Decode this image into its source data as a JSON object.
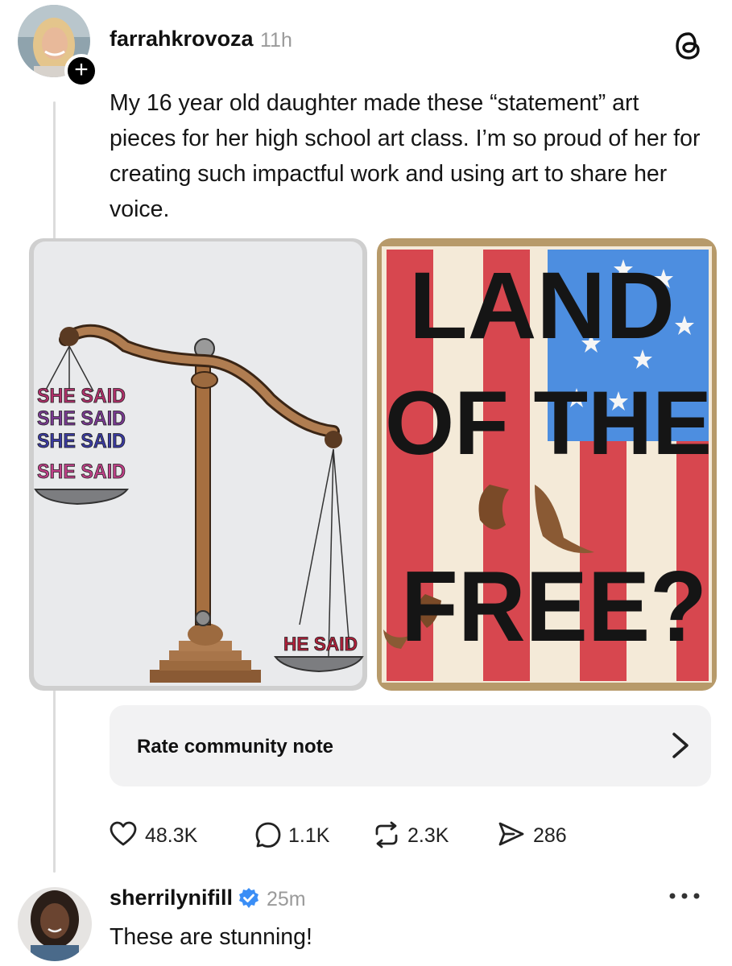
{
  "post": {
    "username": "farrahkrovoza",
    "time": "11h",
    "follow_symbol": "+",
    "text": "My 16 year old daughter made these “statement” art pieces for her high school art class. I’m so proud of her for creating such impactful work and using art to share her voice.",
    "images": {
      "left": {
        "pan_text_lines": [
          "SHE SAID",
          "SHE SAID",
          "SHE SAID",
          "SHE SAID"
        ],
        "right_pan_text": "HE SAID"
      },
      "right": {
        "text_lines": [
          "LAND",
          "OF THE",
          "FREE?"
        ]
      }
    },
    "community_note": {
      "label": "Rate community note",
      "chevron": "chevron-right-icon"
    },
    "actions": {
      "likes": "48.3K",
      "comments": "1.1K",
      "reposts": "2.3K",
      "shares": "286"
    }
  },
  "reply": {
    "username": "sherrilynifill",
    "verified": true,
    "time": "25m",
    "text": "These are stunning!"
  },
  "colors": {
    "verified_blue": "#3a8ef6",
    "secondary_text": "#9a9a9a",
    "note_background": "#f2f2f3"
  }
}
